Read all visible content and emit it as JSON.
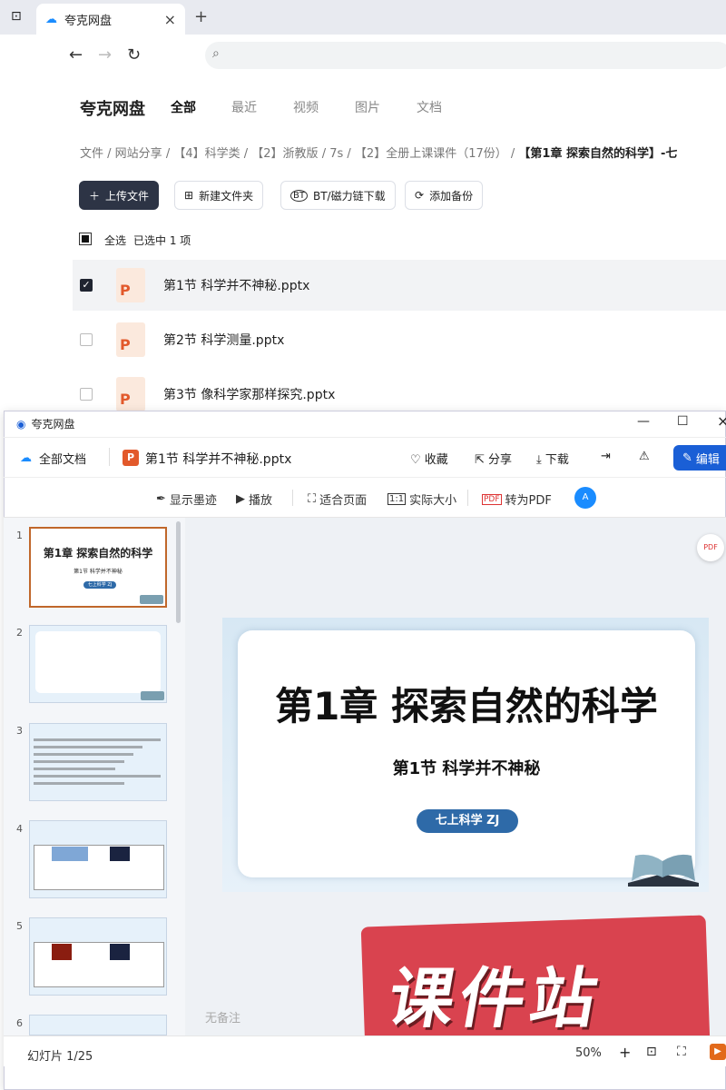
{
  "browser": {
    "tab_title": "夸克网盘"
  },
  "page": {
    "brand": "夸克网盘",
    "nav_tabs": [
      "全部",
      "最近",
      "视频",
      "图片",
      "文档"
    ],
    "breadcrumb": [
      "文件",
      "网站分享",
      "【4】科学类",
      "【2】浙教版",
      "7s",
      "【2】全册上课课件（17份）",
      "【第1章 探索自然的科学】-七"
    ],
    "actions": {
      "upload": "上传文件",
      "new_folder": "新建文件夹",
      "bt_download": "BT/磁力链下载",
      "add_backup": "添加备份"
    },
    "select_all": "全选",
    "selected_info": "已选中 1 项",
    "files": [
      {
        "name": "第1节 科学并不神秘.pptx",
        "checked": true
      },
      {
        "name": "第2节 科学测量.pptx",
        "checked": false
      },
      {
        "name": "第3节 像科学家那样探究.pptx",
        "checked": false
      }
    ]
  },
  "viewer": {
    "window_title": "夸克网盘",
    "all_docs": "全部文档",
    "file_name": "第1节 科学并不神秘.pptx",
    "actions": {
      "favorite": "收藏",
      "share": "分享",
      "download": "下载",
      "edit": "编辑"
    },
    "toolbar": {
      "show_ink": "显示墨迹",
      "play": "播放",
      "fit_page": "适合页面",
      "actual_size": "实际大小",
      "to_pdf": "转为PDF"
    },
    "slide": {
      "title": "第1章  探索自然的科学",
      "subtitle": "第1节  科学并不神秘",
      "badge": "七上科学  ZJ"
    },
    "thumbnails": [
      "1",
      "2",
      "3",
      "4",
      "5",
      "6"
    ],
    "thumb1": {
      "title": "第1章  探索自然的科学",
      "subtitle": "第1节  科学并不神秘",
      "badge": "七上科学 ZJ"
    },
    "notes_placeholder": "无备注",
    "slide_counter": "幻灯片 1/25",
    "zoom": "50%",
    "watermark": "课件站"
  },
  "colors": {
    "accent": "#1a5fd6",
    "badge": "#2e6aa8",
    "upload_btn": "#2d3445",
    "selected_row": "#f2f3f5",
    "stamp": "#d9434f"
  }
}
